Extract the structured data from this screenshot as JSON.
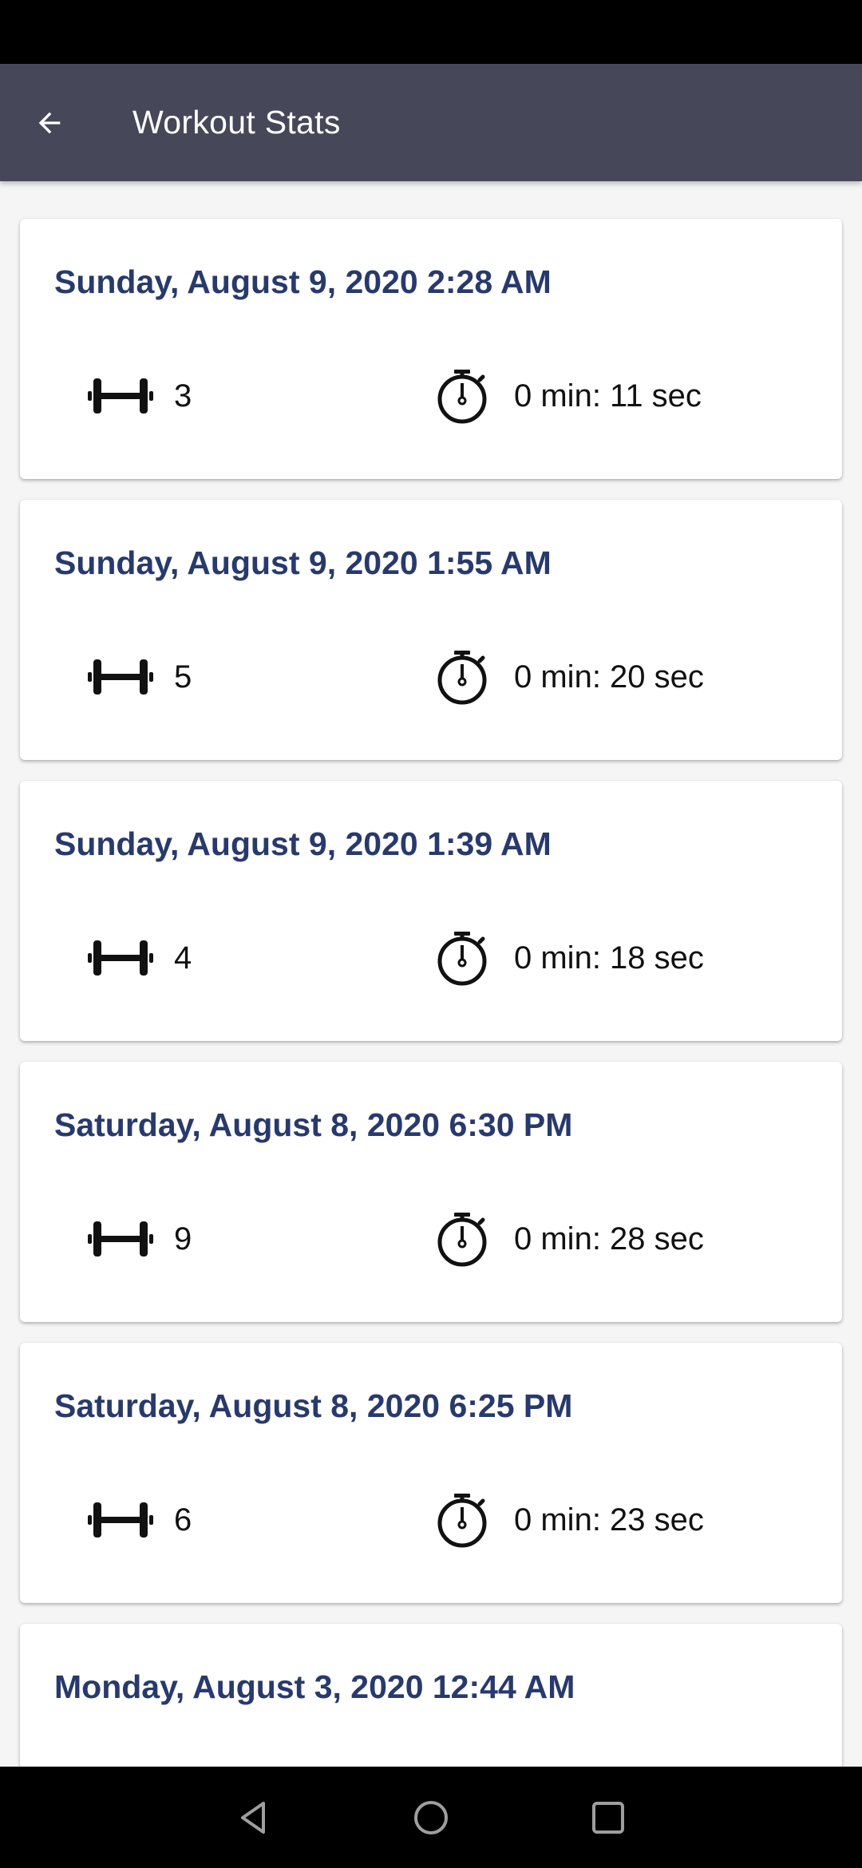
{
  "app_bar": {
    "title": "Workout Stats",
    "back_icon": "arrow-left-icon",
    "color": "#464859"
  },
  "workouts": [
    {
      "date": "Sunday, August 9, 2020 2:28 AM",
      "reps": "3",
      "duration": "0 min: 11 sec"
    },
    {
      "date": "Sunday, August 9, 2020 1:55 AM",
      "reps": "5",
      "duration": "0 min: 20 sec"
    },
    {
      "date": "Sunday, August 9, 2020 1:39 AM",
      "reps": "4",
      "duration": "0 min: 18 sec"
    },
    {
      "date": "Saturday, August 8, 2020 6:30 PM",
      "reps": "9",
      "duration": "0 min: 28 sec"
    },
    {
      "date": "Saturday, August 8, 2020 6:25 PM",
      "reps": "6",
      "duration": "0 min: 23 sec"
    },
    {
      "date": "Monday, August 3, 2020 12:44 AM",
      "reps": "",
      "duration": ""
    }
  ],
  "icons": {
    "reps": "dumbbell-icon",
    "duration": "stopwatch-icon"
  },
  "colors": {
    "date_text": "#283a6c",
    "card_bg": "#ffffff",
    "page_bg": "#f5f5f5"
  },
  "nav_bar": {
    "back": "triangle-back-icon",
    "home": "circle-home-icon",
    "recents": "square-recents-icon"
  }
}
